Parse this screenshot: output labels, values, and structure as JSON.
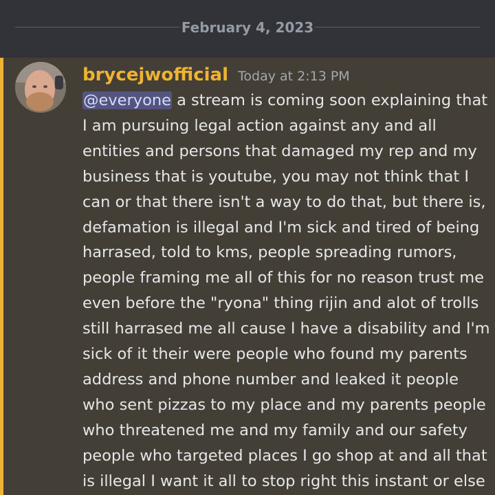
{
  "date_divider": {
    "label": "February 4, 2023"
  },
  "message": {
    "author": "brycejwofficial",
    "timestamp": "Today at 2:13 PM",
    "mention": "@everyone",
    "lines": [
      " a stream is coming soon explaining that",
      "I am pursuing legal action against any and all",
      "entities and persons that damaged my rep and my",
      "business that is youtube, you may not think that I",
      "can or that there isn't a way to do that, but there is,",
      "defamation is illegal and I'm sick and tired of being",
      "harrased, told to kms, people spreading rumors,",
      "people framing me all of this for no reason trust me",
      "even before the \"ryona\" thing rijin and alot of trolls",
      "still harrased me all cause I have a disability and I'm",
      "sick of it their were people who found my parents",
      "address and phone number and leaked it people",
      "who sent pizzas to my place and my parents people",
      "who threatened me and my family and our safety",
      "people who targeted places I go shop at and all that",
      "is illegal I want it all to stop right this instant or else"
    ]
  },
  "colors": {
    "author": "#f0b232",
    "highlight_bar": "#f0b232",
    "mention_bg": "#54557e",
    "message_bg": "#433f37",
    "top_bg": "#313338"
  }
}
